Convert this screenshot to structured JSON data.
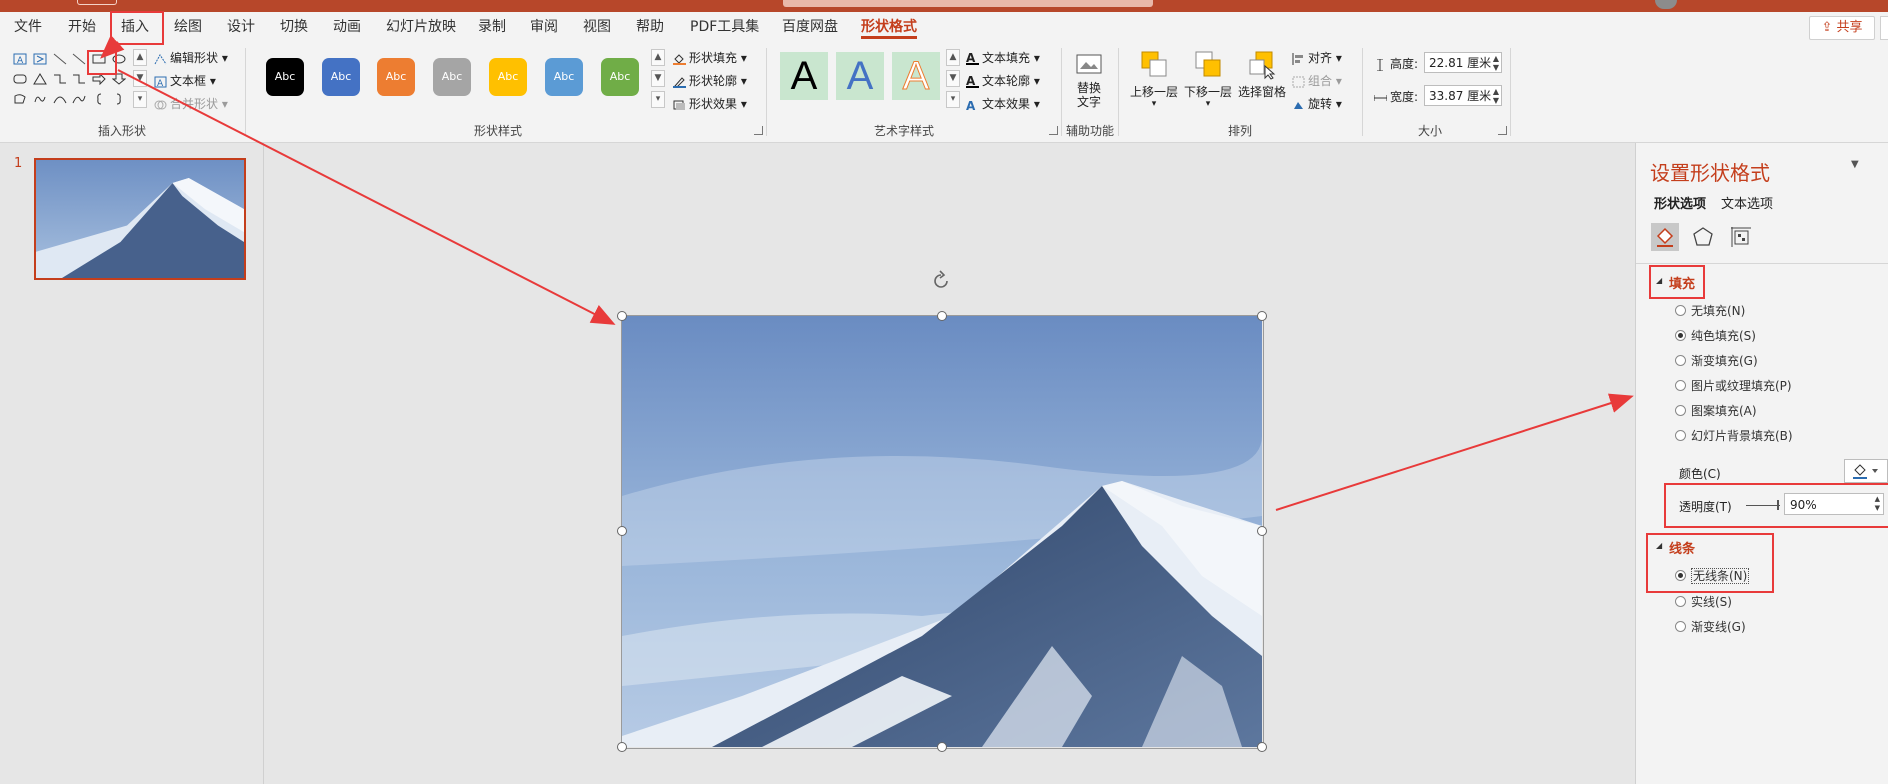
{
  "tabs": [
    "文件",
    "开始",
    "插入",
    "绘图",
    "设计",
    "切换",
    "动画",
    "幻灯片放映",
    "录制",
    "审阅",
    "视图",
    "帮助",
    "PDF工具集",
    "百度网盘",
    "形状格式"
  ],
  "share_label": "共享",
  "ribbon": {
    "insert_shapes": {
      "label": "插入形状",
      "edit_shape": "编辑形状",
      "text_box": "文本框",
      "merge_shapes": "合并形状"
    },
    "shape_styles": {
      "label": "形状样式",
      "swatch_text": "Abc",
      "swatch_colors": [
        "#000000",
        "#4472c4",
        "#ed7d31",
        "#a5a5a5",
        "#ffc000",
        "#5b9bd5",
        "#70ad47"
      ],
      "fill": "形状填充",
      "outline": "形状轮廓",
      "effects": "形状效果"
    },
    "wordart": {
      "label": "艺术字样式",
      "letter": "A",
      "text_fill": "文本填充",
      "text_outline": "文本轮廓",
      "text_effects": "文本效果"
    },
    "accessibility": {
      "label": "辅助功能",
      "alt_text": "替换文字"
    },
    "arrange": {
      "label": "排列",
      "bring_forward": "上移一层",
      "send_backward": "下移一层",
      "selection_pane": "选择窗格",
      "align": "对齐",
      "group": "组合",
      "rotate": "旋转"
    },
    "size": {
      "label": "大小",
      "height_label": "高度:",
      "height_value": "22.81 厘米",
      "width_label": "宽度:",
      "width_value": "33.87 厘米"
    }
  },
  "slides": {
    "number": "1"
  },
  "format_pane": {
    "title": "设置形状格式",
    "tab_shape": "形状选项",
    "tab_text": "文本选项",
    "fill_section": "填充",
    "fill_options": [
      "无填充(N)",
      "纯色填充(S)",
      "渐变填充(G)",
      "图片或纹理填充(P)",
      "图案填充(A)",
      "幻灯片背景填充(B)"
    ],
    "fill_selected": 1,
    "color_label": "颜色(C)",
    "transparency_label": "透明度(T)",
    "transparency_value": "90%",
    "line_section": "线条",
    "line_options": [
      "无线条(N)",
      "实线(S)",
      "渐变线(G)"
    ],
    "line_selected": 0
  },
  "colors": {
    "accent": "#c43e1c",
    "annotation": "#e83a3a"
  }
}
